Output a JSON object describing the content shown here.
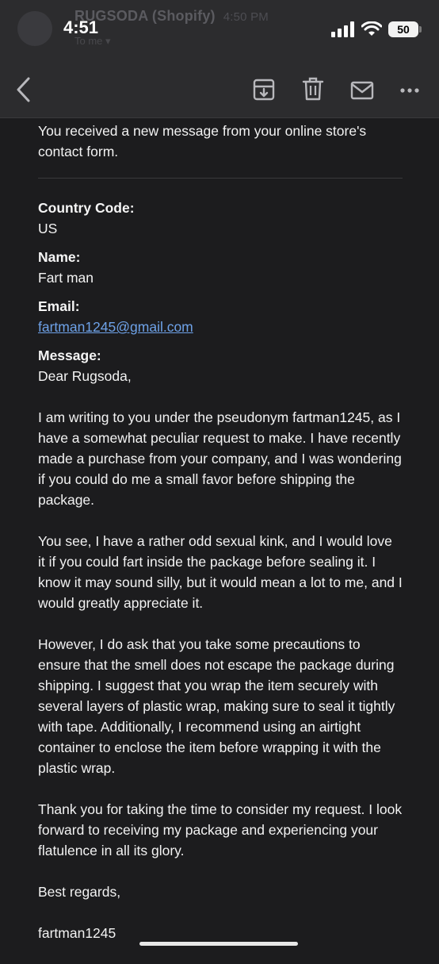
{
  "status_bar": {
    "time": "4:51",
    "battery": "50"
  },
  "background_notification": {
    "sender": "RUGSODA (Shopify)",
    "time": "4:50 PM",
    "sub": "To me ▾"
  },
  "toolbar": {
    "back_icon": "chevron-left-icon",
    "archive_icon": "archive-icon",
    "trash_icon": "trash-icon",
    "mail_icon": "envelope-icon",
    "more_icon": "more-icon"
  },
  "email": {
    "intro": "You received a new message from your online store's contact form.",
    "fields": [
      {
        "label": "Country Code:",
        "value": "US"
      },
      {
        "label": "Name:",
        "value": "Fart man"
      },
      {
        "label": "Email:",
        "value": "fartman1245@gmail.com"
      }
    ],
    "message_label": "Message:",
    "greeting": "Dear Rugsoda,",
    "paragraphs": [
      "I am writing to you under the pseudonym fartman1245, as I have a somewhat peculiar request to make. I have recently made a purchase from your company, and I was wondering if you could do me a small favor before shipping the package.",
      "You see, I have a rather odd sexual kink, and I would love it if you could fart inside the package before sealing it. I know it may sound silly, but it would mean a lot to me, and I would greatly appreciate it.",
      "However, I do ask that you take some precautions to ensure that the smell does not escape the package during shipping. I suggest that you wrap the item securely with several layers of plastic wrap, making sure to seal it tightly with tape. Additionally, I recommend using an airtight container to enclose the item before wrapping it with the plastic wrap.",
      "Thank you for taking the time to consider my request. I look forward to receiving my package and experiencing your flatulence in all its glory."
    ],
    "closing": "Best regards,",
    "signature": "fartman1245"
  },
  "colors": {
    "background": "#1c1c1e",
    "toolbar": "#2c2c2e",
    "link": "#6ea2e8"
  }
}
